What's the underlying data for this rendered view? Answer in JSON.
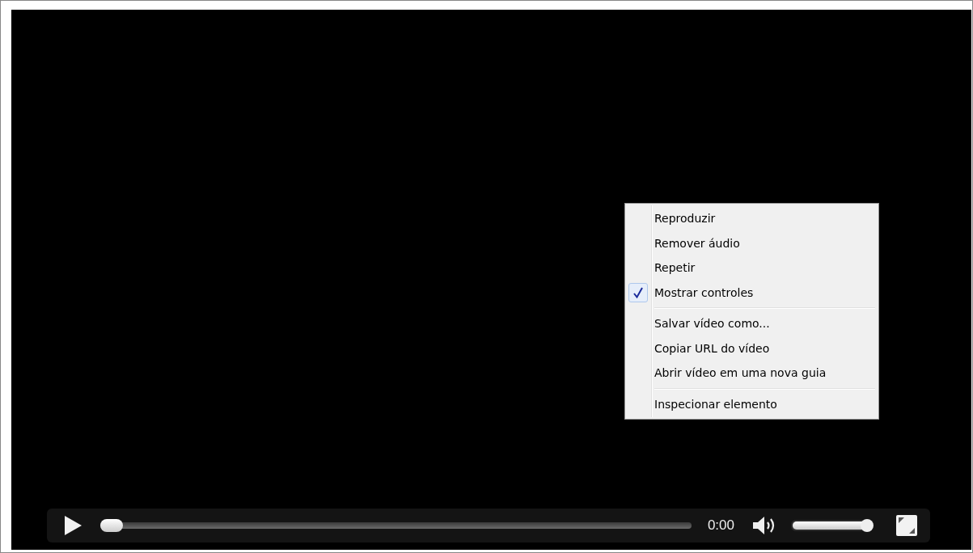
{
  "video_player": {
    "progress": {
      "level": 0
    },
    "time": "0:00",
    "volume": {
      "level": 1
    }
  },
  "context_menu": {
    "items": [
      {
        "kind": "item",
        "label": "Reproduzir",
        "checked": false
      },
      {
        "kind": "item",
        "label": "Remover áudio",
        "checked": false
      },
      {
        "kind": "item",
        "label": "Repetir",
        "checked": false
      },
      {
        "kind": "item",
        "label": "Mostrar controles",
        "checked": true
      },
      {
        "kind": "separator"
      },
      {
        "kind": "item",
        "label": "Salvar vídeo como...",
        "checked": false
      },
      {
        "kind": "item",
        "label": "Copiar URL do vídeo",
        "checked": false
      },
      {
        "kind": "item",
        "label": "Abrir vídeo em uma nova guia",
        "checked": false
      },
      {
        "kind": "separator"
      },
      {
        "kind": "item",
        "label": "Inspecionar elemento",
        "checked": false
      }
    ]
  }
}
